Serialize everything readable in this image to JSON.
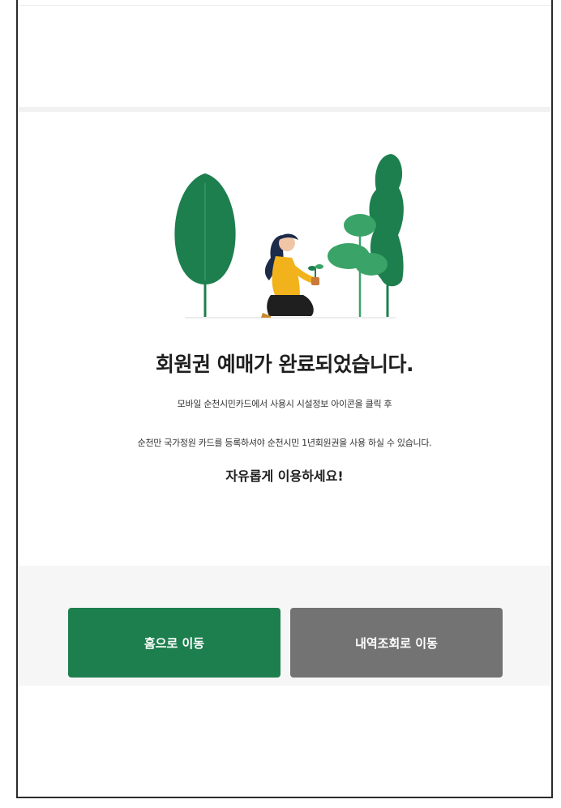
{
  "colors": {
    "primary_green": "#1e7f4e",
    "secondary_gray": "#737373",
    "tree_dark": "#1e7f4e",
    "tree_light": "#3aa368",
    "shirt_yellow": "#f2b21b",
    "hair_navy": "#1c2b4a"
  },
  "illustration": {
    "icon": "gardening-woman-with-trees-illustration"
  },
  "message": {
    "title": "회원권 예매가 완료되었습니다.",
    "line1": "모바일 순천시민카드에서 사용시 시설정보 아이콘을 클릭 후",
    "line2": "순천만 국가정원 카드를 등록하셔야 순천시민 1년회원권을 사용 하실 수 있습니다.",
    "enjoy": "자유롭게 이용하세요!"
  },
  "buttons": {
    "home_label": "홈으로 이동",
    "history_label": "내역조회로 이동"
  }
}
